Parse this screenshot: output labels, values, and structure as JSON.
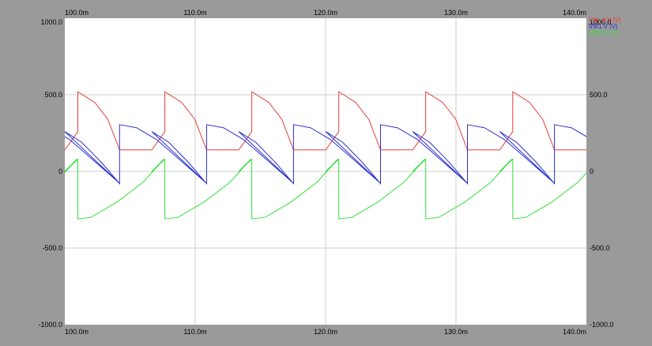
{
  "chart_data": {
    "type": "line",
    "x_ticks": [
      "100.0m",
      "110.0m",
      "120.0m",
      "130.0m",
      "140.0m"
    ],
    "y_ticks": [
      "1000.0",
      "500.0",
      "0",
      "-500.0",
      "-1000.0"
    ],
    "xlim": [
      100,
      140
    ],
    "ylim": [
      -1000,
      1000
    ],
    "grid": true,
    "legend_position": "top-right",
    "period": 6.67,
    "series": [
      {
        "name": "VM_d.V [V]",
        "color": "#e83b3b",
        "points": [
          [
            100.0,
            140
          ],
          [
            101.0,
            260
          ],
          [
            101.0,
            520
          ],
          [
            102.3,
            450
          ],
          [
            103.3,
            340
          ],
          [
            104.2,
            140
          ],
          [
            104.2,
            140
          ]
        ]
      },
      {
        "name": "VM1.V [V]",
        "color": "#2a2fd0",
        "points": [
          [
            100.0,
            260
          ],
          [
            101.3,
            190
          ],
          [
            102.8,
            60
          ],
          [
            104.2,
            -80
          ],
          [
            104.2,
            305
          ],
          [
            105.5,
            285
          ],
          [
            107.0,
            210
          ],
          [
            108.5,
            100
          ],
          [
            110.9,
            -80
          ]
        ]
      },
      {
        "name": "VM2.V [V]",
        "color": "#2fe23a",
        "points": [
          [
            100.0,
            0
          ],
          [
            101.0,
            80
          ],
          [
            101.0,
            -310
          ],
          [
            102.0,
            -300
          ],
          [
            104.0,
            -200
          ],
          [
            106.0,
            -70
          ],
          [
            107.6,
            80
          ]
        ]
      }
    ]
  }
}
